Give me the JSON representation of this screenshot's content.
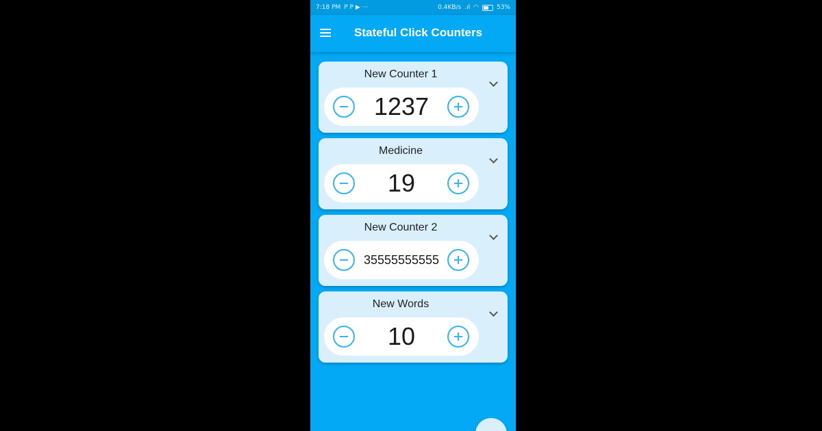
{
  "status_bar": {
    "time": "7:18 PM",
    "left_icons": "P P ▶ ···",
    "network_speed": "0.4KB/s",
    "signal": ".ıl",
    "wifi_icon": "wifi-icon",
    "battery_percent": "53%"
  },
  "app_bar": {
    "title": "Stateful Click Counters",
    "menu_icon": "menu-icon"
  },
  "colors": {
    "primary": "#03a9f4",
    "card": "#d9f0fc",
    "button_outline": "#35b3ea"
  },
  "counters": [
    {
      "name": "New Counter 1",
      "value": "1237"
    },
    {
      "name": "Medicine",
      "value": "19"
    },
    {
      "name": "New Counter 2",
      "value": "35555555555"
    },
    {
      "name": "New Words",
      "value": "10"
    }
  ]
}
